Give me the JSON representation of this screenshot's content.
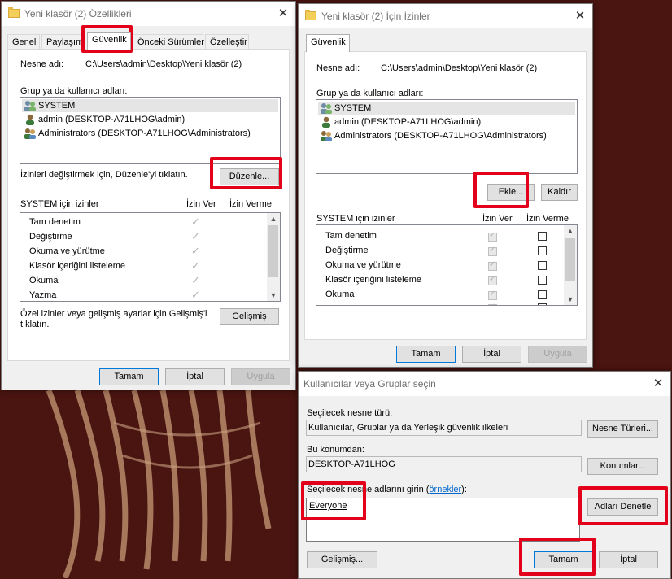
{
  "colors": {
    "highlight": "#e3001b",
    "background": "#4a1410",
    "link": "#0066cc"
  },
  "props": {
    "title": "Yeni klasör (2) Özellikleri",
    "tabs": [
      "Genel",
      "Paylaşım",
      "Güvenlik",
      "Önceki Sürümler",
      "Özelleştir"
    ],
    "object_label": "Nesne adı:",
    "object_value": "C:\\Users\\admin\\Desktop\\Yeni klasör (2)",
    "group_label": "Grup ya da kullanıcı adları:",
    "users": [
      "SYSTEM",
      "admin (DESKTOP-A71LHOG\\admin)",
      "Administrators (DESKTOP-A71LHOG\\Administrators)"
    ],
    "change_text": "İzinleri değiştirmek için, Düzenle'yi tıklatın.",
    "edit_button": "Düzenle...",
    "perm_title": "SYSTEM için izinler",
    "allow_header": "İzin Ver",
    "deny_header": "İzin Verme",
    "permissions": [
      "Tam denetim",
      "Değiştirme",
      "Okuma ve yürütme",
      "Klasör içeriğini listeleme",
      "Okuma",
      "Yazma"
    ],
    "advanced_text_1": "Özel izinler veya gelişmiş ayarlar için Gelişmiş'i",
    "advanced_text_2": "tıklatın.",
    "advanced_button": "Gelişmiş",
    "ok": "Tamam",
    "cancel": "İptal",
    "apply": "Uygula"
  },
  "perms": {
    "title": "Yeni klasör (2) İçin İzinler",
    "tab": "Güvenlik",
    "object_label": "Nesne adı:",
    "object_value": "C:\\Users\\admin\\Desktop\\Yeni klasör (2)",
    "group_label": "Grup ya da kullanıcı adları:",
    "users": [
      "SYSTEM",
      "admin (DESKTOP-A71LHOG\\admin)",
      "Administrators (DESKTOP-A71LHOG\\Administrators)"
    ],
    "add_button": "Ekle...",
    "remove_button": "Kaldır",
    "perm_title": "SYSTEM için izinler",
    "allow_header": "İzin Ver",
    "deny_header": "İzin Verme",
    "permissions": [
      "Tam denetim",
      "Değiştirme",
      "Okuma ve yürütme",
      "Klasör içeriğini listeleme",
      "Okuma"
    ],
    "ok": "Tamam",
    "cancel": "İptal",
    "apply": "Uygula"
  },
  "select": {
    "title": "Kullanıcılar veya Gruplar seçin",
    "type_label": "Seçilecek nesne türü:",
    "type_value": "Kullanıcılar, Gruplar ya da Yerleşik güvenlik ilkeleri",
    "types_button": "Nesne Türleri...",
    "location_label": "Bu konumdan:",
    "location_value": "DESKTOP-A71LHOG",
    "locations_button": "Konumlar...",
    "enter_label": "Seçilecek nesne adlarını girin (",
    "examples_link": "örnekler",
    "enter_label_end": "):",
    "entered_value": "Everyone",
    "check_names_button": "Adları Denetle",
    "advanced_button": "Gelişmiş...",
    "ok": "Tamam",
    "cancel": "İptal"
  }
}
